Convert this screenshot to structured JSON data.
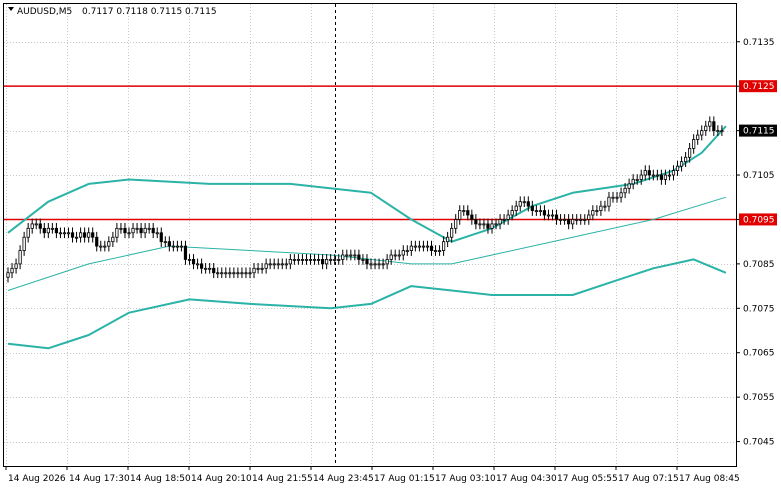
{
  "header": {
    "symbol_label": "AUDUSD,M5",
    "ohlc_label": "0.7117 0.7118 0.7115 0.7115"
  },
  "colors": {
    "background": "#ffffff",
    "grid": "#c8c8c8",
    "frame": "#000000",
    "candle": "#000000",
    "bands": "#2ab3a6",
    "ma": "#2ab3a6",
    "level": "#e00000",
    "level_tag_bg": "#e00000",
    "level_tag_text": "#ffffff",
    "current_tag_bg": "#000000",
    "current_tag_text": "#ffffff"
  },
  "chart_data": {
    "type": "candlestick",
    "title": "AUDUSD,M5",
    "ylim": [
      0.70395,
      0.71435
    ],
    "y_ticks": [
      "0.7135",
      "0.7125",
      "0.7115",
      "0.7105",
      "0.7095",
      "0.7085",
      "0.7075",
      "0.7065",
      "0.7055",
      "0.7045"
    ],
    "x_ticks": [
      "14 Aug 2026",
      "14 Aug 17:30",
      "14 Aug 18:50",
      "14 Aug 20:10",
      "14 Aug 21:55",
      "14 Aug 23:45",
      "17 Aug 01:15",
      "17 Aug 03:10",
      "17 Aug 04:30",
      "17 Aug 05:55",
      "17 Aug 07:15",
      "17 Aug 08:45"
    ],
    "grid": true,
    "candle_count": 180,
    "candles_close": [
      0.7083,
      0.7084,
      0.7085,
      0.7088,
      0.7091,
      0.7093,
      0.7094,
      0.7094,
      0.7093,
      0.7092,
      0.7093,
      0.7093,
      0.7092,
      0.7092,
      0.7092,
      0.7092,
      0.7091,
      0.7091,
      0.7092,
      0.7091,
      0.7092,
      0.7091,
      0.7089,
      0.7089,
      0.7089,
      0.709,
      0.7091,
      0.7093,
      0.7093,
      0.7092,
      0.7092,
      0.7093,
      0.7093,
      0.7092,
      0.7093,
      0.7093,
      0.7092,
      0.7092,
      0.709,
      0.709,
      0.7089,
      0.7089,
      0.7089,
      0.7089,
      0.7086,
      0.7086,
      0.7085,
      0.7085,
      0.7084,
      0.7084,
      0.7084,
      0.7083,
      0.7083,
      0.7083,
      0.7083,
      0.7083,
      0.7083,
      0.7083,
      0.7083,
      0.7083,
      0.7083,
      0.7084,
      0.7084,
      0.7084,
      0.7085,
      0.7085,
      0.7085,
      0.7085,
      0.7085,
      0.7085,
      0.7086,
      0.7086,
      0.7086,
      0.7086,
      0.7086,
      0.7086,
      0.7086,
      0.7086,
      0.7085,
      0.7086,
      0.7086,
      0.7086,
      0.7086,
      0.7087,
      0.7087,
      0.7087,
      0.7087,
      0.7086,
      0.7086,
      0.7085,
      0.7085,
      0.7085,
      0.7085,
      0.7085,
      0.7086,
      0.7087,
      0.7087,
      0.7087,
      0.7088,
      0.7088,
      0.7089,
      0.7089,
      0.7089,
      0.7089,
      0.7089,
      0.7088,
      0.7088,
      0.7088,
      0.709,
      0.7091,
      0.7093,
      0.7095,
      0.7097,
      0.7097,
      0.7096,
      0.7095,
      0.7094,
      0.7094,
      0.7094,
      0.7093,
      0.7094,
      0.7094,
      0.7095,
      0.7095,
      0.7096,
      0.7097,
      0.7098,
      0.7099,
      0.7099,
      0.7098,
      0.7097,
      0.7097,
      0.7097,
      0.7096,
      0.7096,
      0.7096,
      0.7095,
      0.7095,
      0.7095,
      0.7094,
      0.7095,
      0.7095,
      0.7095,
      0.7095,
      0.7096,
      0.7097,
      0.7097,
      0.7098,
      0.7098,
      0.71,
      0.71,
      0.71,
      0.7101,
      0.7102,
      0.7103,
      0.7104,
      0.7104,
      0.7105,
      0.7106,
      0.7105,
      0.7105,
      0.7105,
      0.7104,
      0.7105,
      0.7105,
      0.7106,
      0.7107,
      0.7108,
      0.7109,
      0.7111,
      0.7113,
      0.7114,
      0.7115,
      0.7116,
      0.7117,
      0.7115,
      0.7115,
      0.7115
    ],
    "series": [
      {
        "name": "",
        "kind": "band_upper",
        "x": [
          0,
          10,
          20,
          30,
          50,
          70,
          90,
          100,
          110,
          120,
          130,
          140,
          155,
          165,
          172,
          178
        ],
        "values": [
          0.7092,
          0.7099,
          0.7103,
          0.7104,
          0.7103,
          0.7103,
          0.7101,
          0.7095,
          0.709,
          0.7093,
          0.7098,
          0.7101,
          0.7103,
          0.7106,
          0.711,
          0.7116
        ]
      },
      {
        "name": "",
        "kind": "band_lower",
        "x": [
          0,
          10,
          20,
          30,
          45,
          60,
          80,
          90,
          100,
          110,
          120,
          130,
          140,
          150,
          160,
          170,
          178
        ],
        "values": [
          0.7067,
          0.7066,
          0.7069,
          0.7074,
          0.7077,
          0.7076,
          0.7075,
          0.7076,
          0.708,
          0.7079,
          0.7078,
          0.7078,
          0.7078,
          0.7081,
          0.7084,
          0.7086,
          0.7083
        ]
      },
      {
        "name": "",
        "kind": "moving_average",
        "x": [
          0,
          20,
          40,
          60,
          80,
          100,
          110,
          120,
          140,
          160,
          178
        ],
        "values": [
          0.7079,
          0.7085,
          0.7089,
          0.7088,
          0.7087,
          0.7085,
          0.7085,
          0.7087,
          0.7091,
          0.7095,
          0.71
        ]
      }
    ],
    "levels": [
      {
        "value": 0.7125,
        "label": "0.7125"
      },
      {
        "value": 0.7095,
        "label": "0.7095"
      }
    ],
    "current_price": {
      "value": 0.7115,
      "label": "0.7115"
    },
    "marker_line_candle": 81
  }
}
